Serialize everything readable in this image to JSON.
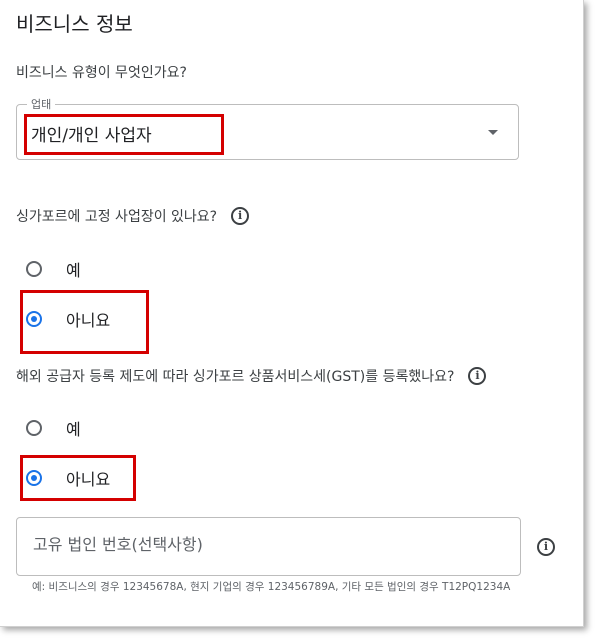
{
  "section_title": "비즈니스 정보",
  "business_type": {
    "question": "비즈니스 유형이 무엇인가요?",
    "field_label": "업태",
    "selected_value": "개인/개인 사업자"
  },
  "fixed_location": {
    "question": "싱가포르에 고정 사업장이 있나요?",
    "options": [
      "예",
      "아니요"
    ],
    "selected": "아니요"
  },
  "gst": {
    "question": "해외 공급자 등록 제도에 따라 싱가포르 상품서비스세(GST)를 등록했나요?",
    "options": [
      "예",
      "아니요"
    ],
    "selected": "아니요"
  },
  "uen": {
    "placeholder": "고유 법인 번호(선택사항)",
    "value": "",
    "helper": "예: 비즈니스의 경우 12345678A, 현지 기업의 경우 123456789A, 기타 모든 법인의 경우 T12PQ1234A"
  },
  "icons": {
    "info": "info-icon",
    "dropdown": "chevron-down-icon"
  },
  "colors": {
    "highlight": "#d40000",
    "radio_selected": "#1a73e8"
  }
}
